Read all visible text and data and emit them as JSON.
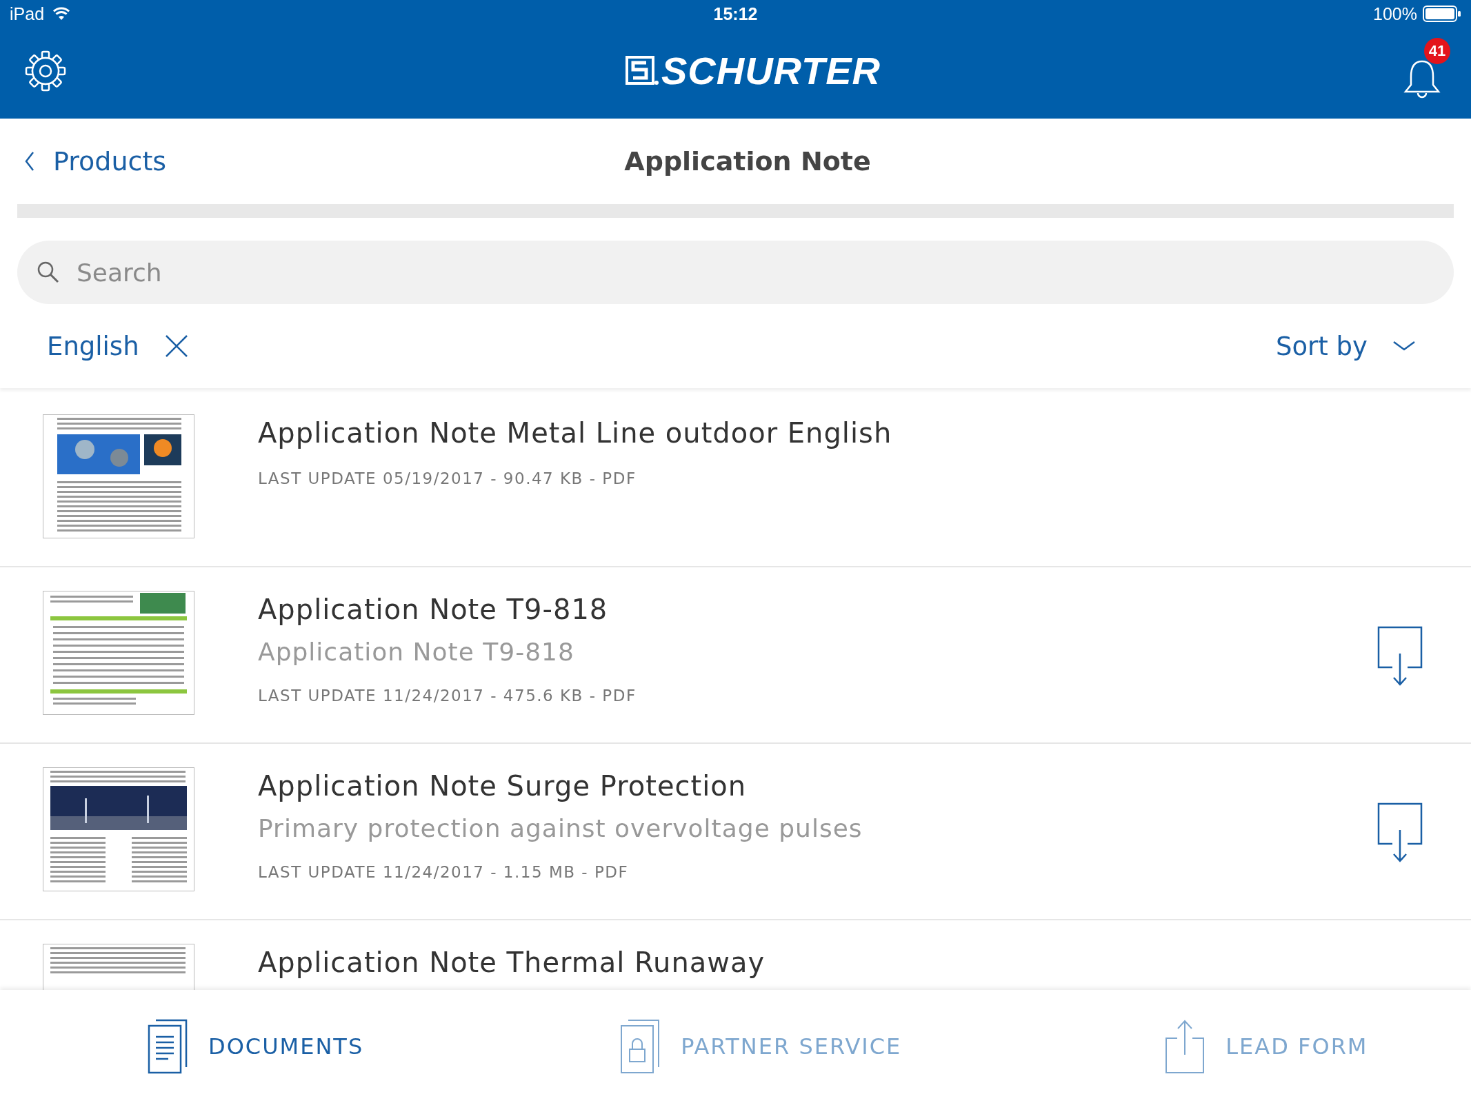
{
  "status_bar": {
    "device": "iPad",
    "time": "15:12",
    "battery": "100%"
  },
  "header": {
    "logo": "SCHURTER",
    "notification_count": "41"
  },
  "nav": {
    "back": "Products",
    "title": "Application Note"
  },
  "search": {
    "placeholder": "Search"
  },
  "filter": {
    "language": "English",
    "sort": "Sort by"
  },
  "documents": [
    {
      "title": "Application Note Metal Line outdoor English",
      "meta": "LAST UPDATE 05/19/2017 - 90.47 KB - PDF",
      "download": false
    },
    {
      "title": "Application Note T9-818",
      "subtitle": "Application Note T9-818",
      "meta": "LAST UPDATE 11/24/2017 - 475.6 KB - PDF",
      "download": true
    },
    {
      "title": "Application Note Surge Protection",
      "subtitle": "Primary protection against overvoltage pulses",
      "meta": "LAST UPDATE 11/24/2017 - 1.15 MB - PDF",
      "download": true
    },
    {
      "title": "Application Note Thermal Runaway",
      "download": false
    }
  ],
  "tab_bar": [
    {
      "kind": "documents",
      "label": "DOCUMENTS",
      "selected": true
    },
    {
      "kind": "partner",
      "label": "PARTNER SERVICE",
      "selected": false
    },
    {
      "kind": "lead",
      "label": "LEAD FORM",
      "selected": false
    }
  ]
}
